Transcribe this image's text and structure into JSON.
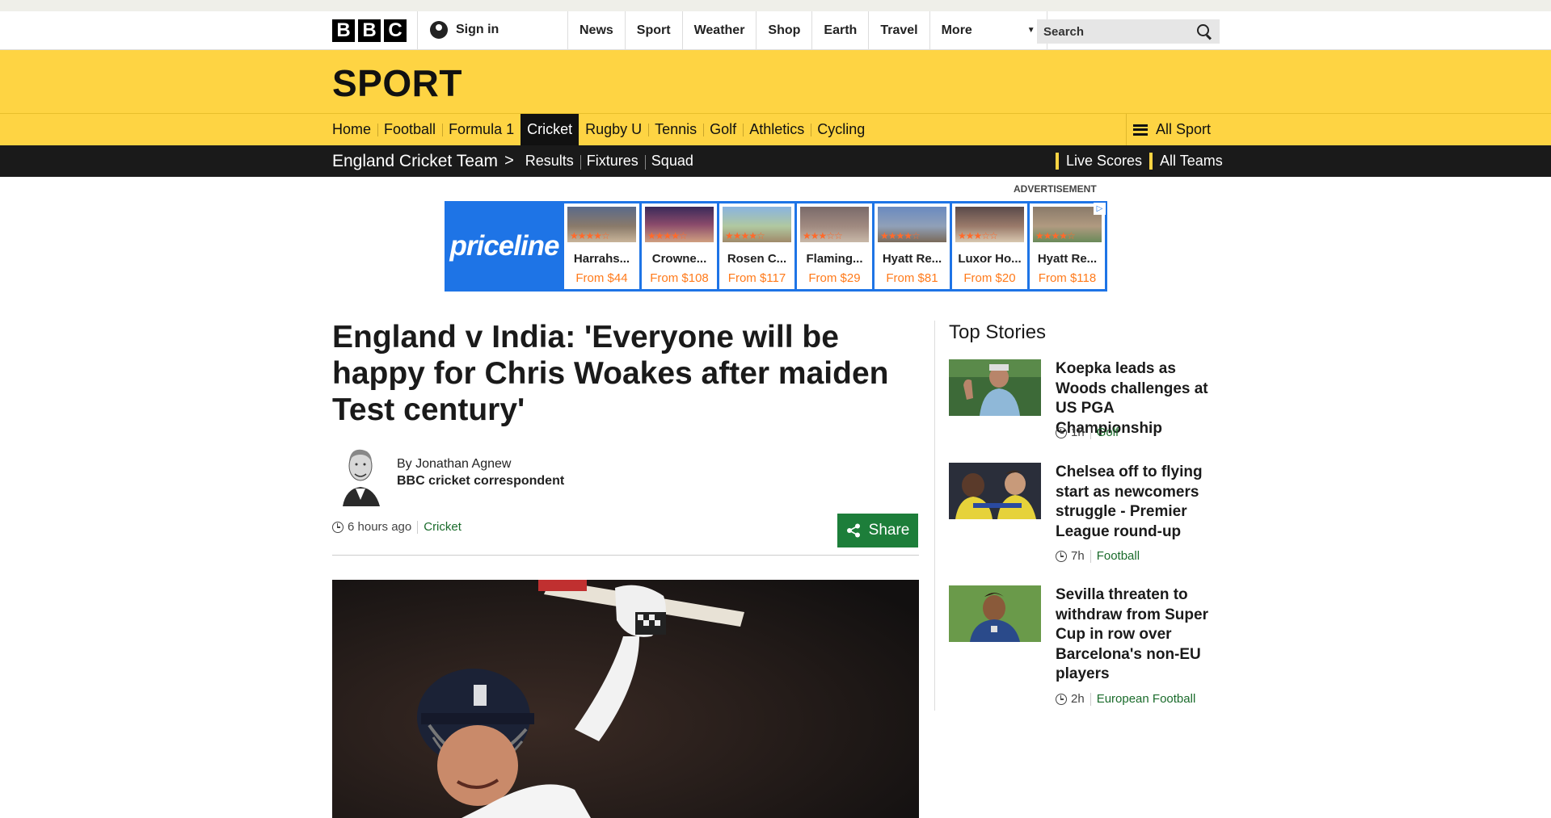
{
  "global_nav": {
    "logo_letters": [
      "B",
      "B",
      "C"
    ],
    "sign_in": "Sign in",
    "items": [
      "News",
      "Sport",
      "Weather",
      "Shop",
      "Earth",
      "Travel"
    ],
    "more": "More",
    "search_placeholder": "Search"
  },
  "sport": {
    "title": "SPORT",
    "nav": [
      "Home",
      "Football",
      "Formula 1",
      "Cricket",
      "Rugby U",
      "Tennis",
      "Golf",
      "Athletics",
      "Cycling"
    ],
    "active": "Cricket",
    "all_sport": "All Sport"
  },
  "team_bar": {
    "title": "England Cricket Team",
    "chevron": ">",
    "links": [
      "Results",
      "Fixtures",
      "Squad"
    ],
    "right_links": [
      "Live Scores",
      "All Teams"
    ]
  },
  "ad": {
    "label": "ADVERTISEMENT",
    "brand": "priceline",
    "hotels": [
      {
        "name": "Harrahs...",
        "price": "From $44"
      },
      {
        "name": "Crowne...",
        "price": "From $108"
      },
      {
        "name": "Rosen C...",
        "price": "From $117"
      },
      {
        "name": "Flaming...",
        "price": "From $29"
      },
      {
        "name": "Hyatt Re...",
        "price": "From $81"
      },
      {
        "name": "Luxor Ho...",
        "price": "From $20"
      },
      {
        "name": "Hyatt Re...",
        "price": "From $118"
      }
    ]
  },
  "article": {
    "headline": "England v India: 'Everyone will be happy for Chris Woakes after maiden Test century'",
    "author": "By Jonathan Agnew",
    "role": "BBC cricket correspondent",
    "time": "6 hours ago",
    "category": "Cricket",
    "share": "Share"
  },
  "top_stories": {
    "title": "Top Stories",
    "items": [
      {
        "title": "Koepka leads as Woods challenges at US PGA Championship",
        "time": "1h",
        "category": "Golf"
      },
      {
        "title": "Chelsea off to flying start as newcomers struggle - Premier League round-up",
        "time": "7h",
        "category": "Football"
      },
      {
        "title": "Sevilla threaten to withdraw from Super Cup in row over Barcelona's non-EU players",
        "time": "2h",
        "category": "European Football"
      }
    ]
  },
  "colors": {
    "sport_yellow": "#fed443",
    "dark_bar": "#1a1a1a",
    "category_green": "#1a6b2b",
    "share_green": "#1d7e3a",
    "priceline_blue": "#1e74e6",
    "price_orange": "#ff7a1a"
  },
  "icons": [
    "user-icon",
    "search-icon",
    "chevron-down-icon",
    "hamburger-icon",
    "clock-icon",
    "share-icon",
    "adchoices-icon"
  ]
}
